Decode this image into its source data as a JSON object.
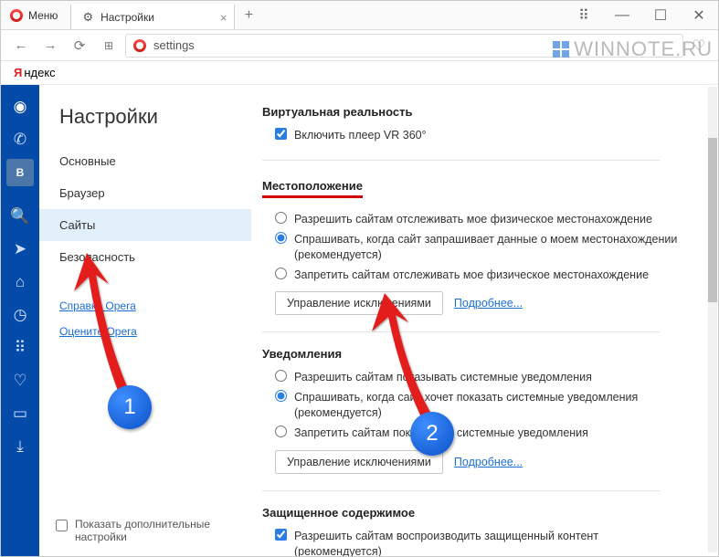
{
  "titlebar": {
    "menu": "Меню",
    "tab": "Настройки"
  },
  "address": {
    "text": "settings"
  },
  "yandex": {
    "letter": "Я",
    "word": "ндекс"
  },
  "watermark": "WINNOTE.RU",
  "sidebar": {
    "title": "Настройки",
    "items": [
      "Основные",
      "Браузер",
      "Сайты",
      "Безопасность"
    ],
    "links": [
      "Справка Opera",
      "Оцените Opera"
    ],
    "show_advanced": "Показать дополнительные настройки"
  },
  "sections": {
    "vr": {
      "title": "Виртуальная реальность",
      "cb": "Включить плеер VR 360°"
    },
    "loc": {
      "title": "Местоположение",
      "o1": "Разрешить сайтам отслеживать мое физическое местонахождение",
      "o2": "Спрашивать, когда сайт запрашивает данные о моем местонахождении (рекомендуется)",
      "o3": "Запретить сайтам отслеживать мое физическое местонахождение",
      "btn": "Управление исключениями",
      "more": "Подробнее..."
    },
    "notif": {
      "title": "Уведомления",
      "o1": "Разрешить сайтам показывать системные уведомления",
      "o2": "Спрашивать, когда сайт хочет показать системные уведомления (рекомендуется)",
      "o3": "Запретить сайтам показывать системные уведомления",
      "btn": "Управление исключениями",
      "more": "Подробнее..."
    },
    "prot": {
      "title": "Защищенное содержимое",
      "cb": "Разрешить сайтам воспроизводить защищенный контент (рекомендуется)"
    }
  },
  "annotations": {
    "b1": "1",
    "b2": "2"
  }
}
